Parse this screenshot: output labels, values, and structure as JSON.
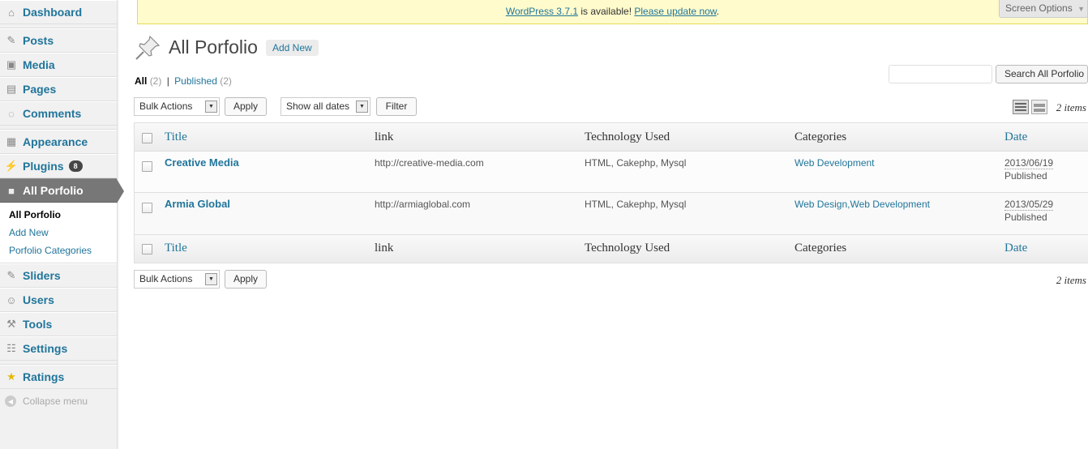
{
  "sidebar": {
    "items": [
      {
        "label": "Dashboard",
        "icon": "dashboard-icon"
      },
      {
        "label": "Posts",
        "icon": "pin-icon"
      },
      {
        "label": "Media",
        "icon": "media-icon"
      },
      {
        "label": "Pages",
        "icon": "pages-icon"
      },
      {
        "label": "Comments",
        "icon": "comment-icon"
      },
      {
        "label": "Appearance",
        "icon": "appearance-icon"
      },
      {
        "label": "Plugins",
        "icon": "plug-icon",
        "badge": "8"
      },
      {
        "label": "All Porfolio",
        "icon": "briefcase-icon"
      },
      {
        "label": "Sliders",
        "icon": "pin-icon"
      },
      {
        "label": "Users",
        "icon": "users-icon"
      },
      {
        "label": "Tools",
        "icon": "tools-icon"
      },
      {
        "label": "Settings",
        "icon": "settings-icon"
      },
      {
        "label": "Ratings",
        "icon": "star-icon"
      }
    ],
    "submenu": [
      "All Porfolio",
      "Add New",
      "Porfolio Categories"
    ],
    "collapse": "Collapse menu"
  },
  "notice": {
    "version_link": "WordPress 3.7.1",
    "middle": " is available! ",
    "update_link": "Please update now",
    "end": "."
  },
  "screen_options": "Screen Options",
  "page": {
    "title": "All Porfolio",
    "add_new": "Add New"
  },
  "filters": {
    "all": "All",
    "all_count": "(2)",
    "sep": "|",
    "published": "Published",
    "published_count": "(2)"
  },
  "search": {
    "button": "Search All Porfolio",
    "value": ""
  },
  "toolbar": {
    "bulk_actions": "Bulk Actions",
    "apply": "Apply",
    "dates": "Show all dates",
    "filter": "Filter",
    "items_count": "2 items"
  },
  "table": {
    "columns": [
      "Title",
      "link",
      "Technology Used",
      "Categories",
      "Date"
    ],
    "rows": [
      {
        "title": "Creative Media",
        "link": "http://creative-media.com",
        "tech": "HTML, Cakephp, Mysql",
        "categories": "Web Development",
        "date": "2013/06/19",
        "status": "Published"
      },
      {
        "title": "Armia Global",
        "link": "http://armiaglobal.com",
        "tech": "HTML, Cakephp, Mysql",
        "categories": "Web Design,Web Development",
        "date": "2013/05/29",
        "status": "Published"
      }
    ]
  },
  "colors": {
    "link": "#21759b",
    "current_menu": "#777777",
    "notice_bg": "#fffbcc"
  }
}
